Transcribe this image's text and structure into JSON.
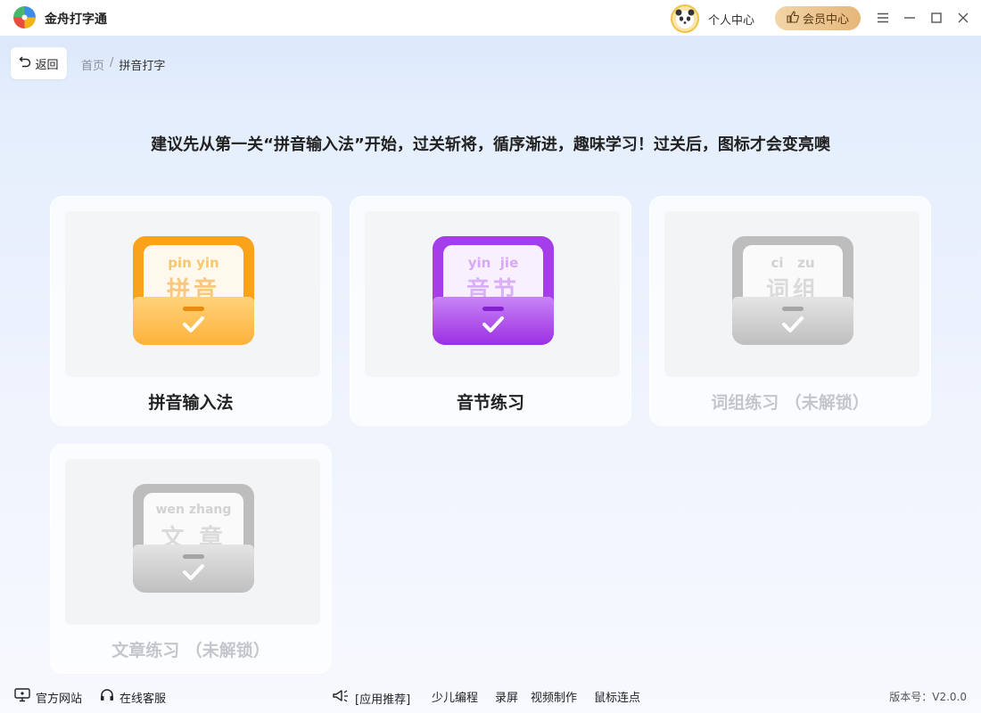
{
  "app": {
    "title": "金舟打字通",
    "logo_icon": "pinwheel-logo-icon"
  },
  "header": {
    "personal_center": "个人中心",
    "member_center": "会员中心",
    "avatar_icon": "panda-avatar-icon"
  },
  "nav": {
    "back_label": "返回",
    "breadcrumb": [
      "首页",
      "/",
      "拼音打字"
    ]
  },
  "hint": "建议先从第一关“拼音输入法”开始，过关斩将，循序渐进，趣味学习！过关后，图标才会变亮噢",
  "cards": [
    {
      "label": "拼音输入法",
      "pinyin": "pin yin",
      "chars": "拼音",
      "color": "#fba21b",
      "locked": false
    },
    {
      "label": "音节练习",
      "pinyin": "yin  jie",
      "chars": "音节",
      "color": "#a53ee8",
      "locked": false
    },
    {
      "label": "词组练习 （未解锁）",
      "pinyin": "ci   zu",
      "chars": "词组",
      "color": "#bdbdbd",
      "locked": true
    },
    {
      "label": "文章练习 （未解锁）",
      "pinyin": "wen zhang",
      "chars": "文 章",
      "color": "#bdbdbd",
      "locked": true
    }
  ],
  "footer": {
    "official_site": "官方网站",
    "online_service": "在线客服",
    "app_recommend": "[应用推荐]",
    "links": [
      "少儿编程",
      "录屏",
      "视频制作",
      "鼠标连点"
    ],
    "version": "版本号：V2.0.0"
  }
}
